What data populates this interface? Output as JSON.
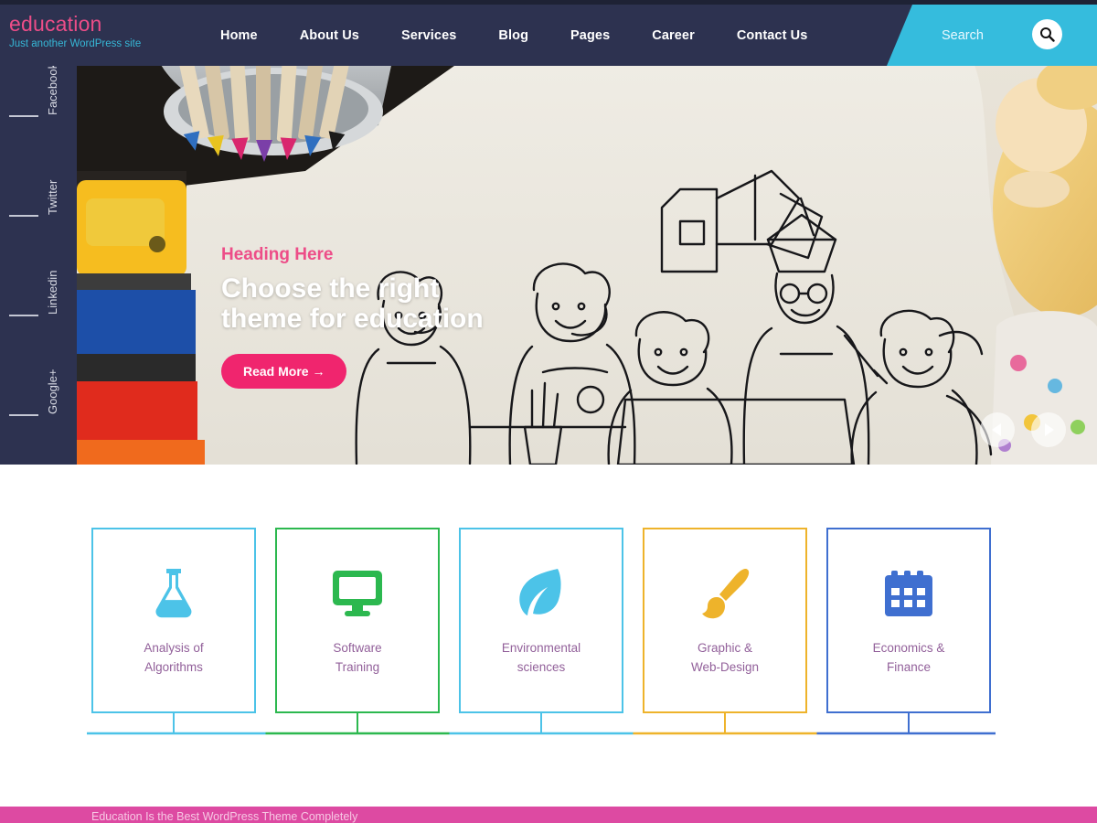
{
  "brand": {
    "title": "education",
    "tagline": "Just another WordPress site",
    "accent_pink": "#ed4d88",
    "accent_cyan": "#36b7d6",
    "header_bg": "#2d3250"
  },
  "nav": {
    "items": [
      {
        "label": "Home"
      },
      {
        "label": "About Us"
      },
      {
        "label": "Services"
      },
      {
        "label": "Blog"
      },
      {
        "label": "Pages"
      },
      {
        "label": "Career"
      },
      {
        "label": "Contact Us"
      }
    ]
  },
  "search": {
    "placeholder": "Search",
    "label": "Search",
    "icon": "search-icon",
    "bg": "#35bcdd"
  },
  "social": {
    "items": [
      {
        "label": "Facebook",
        "icon": "facebook-link"
      },
      {
        "label": "Twitter",
        "icon": "twitter-link"
      },
      {
        "label": "Linkedin",
        "icon": "linkedin-link"
      },
      {
        "label": "Google+",
        "icon": "googleplus-link"
      }
    ]
  },
  "hero": {
    "kicker": "Heading Here",
    "title_line1": "Choose the right",
    "title_line2": "theme for education",
    "button_label": "Read More →",
    "button_color": "#f0256e",
    "prev_icon": "chevron-left-icon",
    "next_icon": "chevron-right-icon"
  },
  "services": {
    "cards": [
      {
        "label_line1": "Analysis of",
        "label_line2": "Algorithms",
        "color": "#4cc3e8",
        "icon": "flask-icon"
      },
      {
        "label_line1": "Software",
        "label_line2": "Training",
        "color": "#2cb84f",
        "icon": "monitor-icon"
      },
      {
        "label_line1": "Environmental",
        "label_line2": "sciences",
        "color": "#4cc3e8",
        "icon": "leaf-icon"
      },
      {
        "label_line1": "Graphic &",
        "label_line2": "Web-Design",
        "color": "#eeb32b",
        "icon": "paintbrush-icon"
      },
      {
        "label_line1": "Economics &",
        "label_line2": "Finance",
        "color": "#3f6fd0",
        "icon": "calendar-icon"
      }
    ],
    "label_color": "#92609a"
  },
  "footer": {
    "text": "Education Is the Best WordPress Theme Completely",
    "bg": "#dd4aa2"
  }
}
